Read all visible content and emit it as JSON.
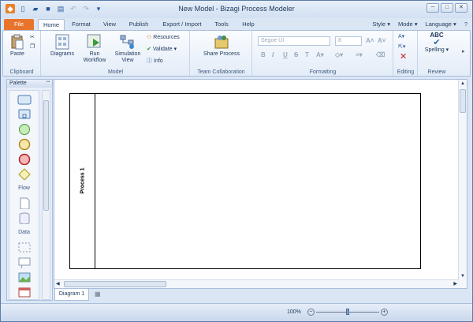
{
  "window": {
    "title": "New Model - Bizagi Process Modeler"
  },
  "tabs": [
    "File",
    "Home",
    "Format",
    "View",
    "Publish",
    "Export / Import",
    "Tools",
    "Help"
  ],
  "right_menus": [
    "Style",
    "Mode",
    "Language"
  ],
  "ribbon": {
    "clipboard": {
      "paste": "Paste",
      "label": "Clipboard"
    },
    "model": {
      "diagrams": "Diagrams",
      "run_workflow_l1": "Run",
      "run_workflow_l2": "Workflow",
      "simulation_l1": "Simulation",
      "simulation_l2": "View",
      "resources": "Resources",
      "validate": "Validate",
      "info": "Info",
      "label": "Model"
    },
    "team": {
      "share": "Share Process",
      "label": "Team Collaboration"
    },
    "formatting": {
      "font": "Segoe UI",
      "size": "8",
      "label": "Formatting"
    },
    "editing": {
      "label": "Editing"
    },
    "review": {
      "spelling": "Spelling",
      "abc": "ABC",
      "label": "Review"
    }
  },
  "palette": {
    "title": "Palette",
    "flow": "Flow",
    "data": "Data"
  },
  "canvas": {
    "pool_name": "Process 1"
  },
  "diagram_tab": "Diagram 1",
  "status": {
    "zoom": "100%"
  },
  "colors": {
    "file_tab": "#e8742c",
    "accent": "#1e395b"
  }
}
